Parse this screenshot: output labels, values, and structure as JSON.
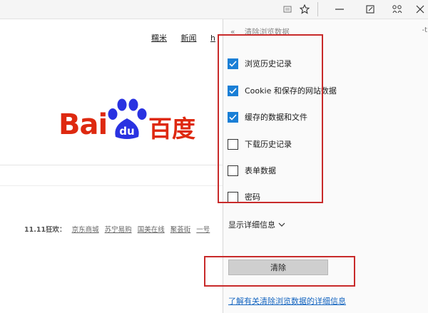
{
  "toplinks": [
    "糯米",
    "新闻",
    "h"
  ],
  "logo": {
    "text_latin": "Bai",
    "paw_text": "du",
    "text_cn": "百度"
  },
  "promo": {
    "label": "11.11狂欢：",
    "links": [
      "京东商城",
      "苏宁易购",
      "国美在线",
      "聚荟街",
      "一号"
    ]
  },
  "panel": {
    "back_label": "«",
    "title": "清除浏览数据",
    "cut_label": "-t",
    "options": [
      {
        "label": "浏览历史记录",
        "checked": true
      },
      {
        "label": "Cookie 和保存的网站数据",
        "checked": true
      },
      {
        "label": "缓存的数据和文件",
        "checked": true
      },
      {
        "label": "下载历史记录",
        "checked": false
      },
      {
        "label": "表单数据",
        "checked": false
      },
      {
        "label": "密码",
        "checked": false
      }
    ],
    "details_label": "显示详细信息",
    "clear_button": "清除",
    "learn_more": "了解有关清除浏览数据的详细信息"
  },
  "colors": {
    "checkbox_checked": "#1a7fd6",
    "annotation": "#c82a2a",
    "baidu_red": "#de2910",
    "baidu_blue": "#2932e1",
    "link_blue": "#1565c0"
  },
  "icons": [
    "reading-list-icon",
    "favorite-star-icon",
    "minimize-icon",
    "notes-icon",
    "share-icon",
    "close-icon",
    "chevron-down-icon",
    "checkmark-icon"
  ]
}
